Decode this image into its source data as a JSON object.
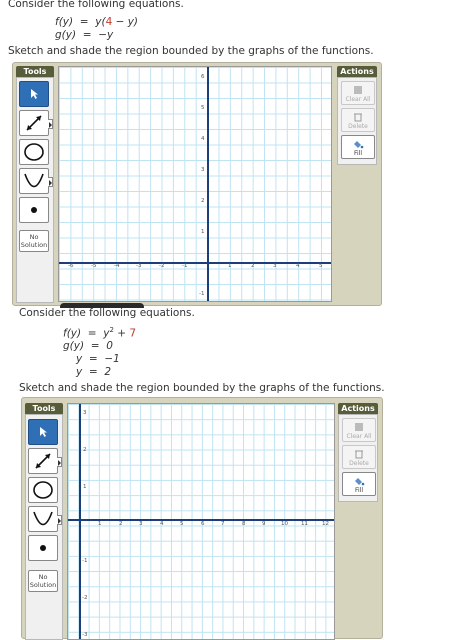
{
  "problem1": {
    "intro": "Consider the following equations.",
    "eq_f_left": "f(y)  =  y(",
    "eq_f_red": "4",
    "eq_f_right": " − y)",
    "eq_g": "g(y)  =  −y",
    "instruction": "Sketch and shade the region bounded by the graphs of the functions."
  },
  "problem2": {
    "intro": "Consider the following equations.",
    "eq_f_left": "f(y)  =  y",
    "eq_f_sup": "2",
    "eq_f_mid": " + ",
    "eq_f_red": "7",
    "eq_g": "g(y)  =  0",
    "eq_y1": "y  =  −1",
    "eq_y2": "y  =  2",
    "instruction": "Sketch and shade the region bounded by the graphs of the functions."
  },
  "widget": {
    "tools_title": "Tools",
    "actions_title": "Actions",
    "no_solution": "No Solution",
    "clear_all": "Clear All",
    "delete": "Delete",
    "fill": "Fill"
  },
  "graph1": {
    "x_ticks": [
      "-6",
      "-5",
      "-4",
      "-3",
      "-2",
      "-1",
      "1",
      "2",
      "3",
      "4",
      "5"
    ],
    "y_ticks": [
      "6",
      "5",
      "4",
      "3",
      "2",
      "1",
      "-1"
    ]
  },
  "graph2": {
    "x_ticks": [
      "1",
      "2",
      "3",
      "4",
      "5",
      "6",
      "7",
      "8",
      "9",
      "10",
      "11",
      "12"
    ],
    "y_ticks": [
      "3",
      "2",
      "1",
      "-1",
      "-2",
      "-3"
    ]
  },
  "colors": {
    "accent": "#2f6fb5",
    "header": "#575c3a",
    "grid": "#bfe3f3",
    "axis": "#1c3f7a",
    "red": "#c0392b"
  }
}
